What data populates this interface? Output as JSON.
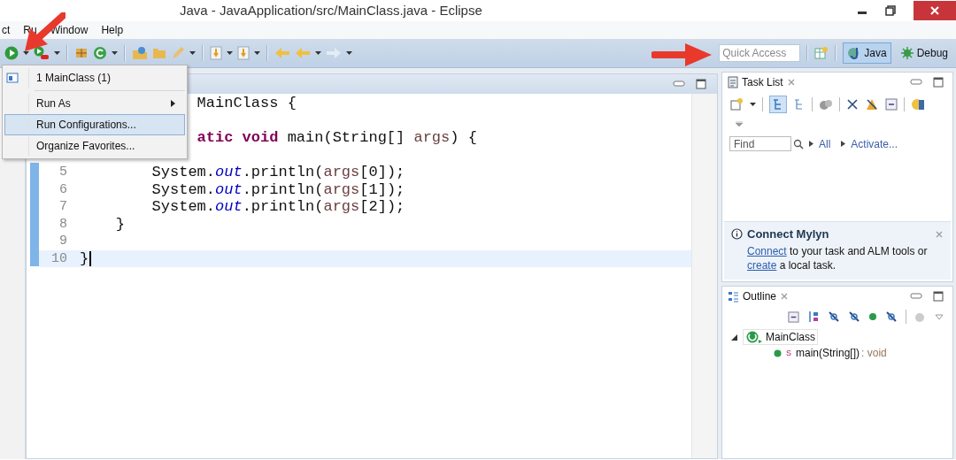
{
  "window": {
    "title": "Java - JavaApplication/src/MainClass.java - Eclipse"
  },
  "menu_bar": [
    "ct",
    "Ru",
    "Window",
    "Help"
  ],
  "quick_access": {
    "placeholder": "Quick Access"
  },
  "perspectives": [
    {
      "label": "Java",
      "selected": true
    },
    {
      "label": "Debug",
      "selected": false
    }
  ],
  "run_menu": [
    {
      "kind": "item",
      "label": "1 MainClass (1)",
      "selected": false
    },
    {
      "kind": "separator"
    },
    {
      "kind": "submenu",
      "label": "Run As",
      "selected": false
    },
    {
      "kind": "item",
      "label": "Run Configurations...",
      "selected": true
    },
    {
      "kind": "item",
      "label": "Organize Favorites...",
      "selected": false
    }
  ],
  "editor": {
    "lines": [
      {
        "current": false,
        "tokens": [
          {
            "kind": "plain",
            "text": "MainClass {"
          }
        ]
      },
      {
        "current": false
      },
      {
        "current": false,
        "tokens": [
          {
            "kind": "keyword",
            "text": "atic void"
          },
          {
            "kind": "plain",
            "text": " main(String[] "
          },
          {
            "kind": "param",
            "text": "args"
          },
          {
            "kind": "plain",
            "text": ") {"
          }
        ]
      },
      {
        "current": false
      },
      {
        "number": "5",
        "current": false,
        "tokens": [
          {
            "kind": "plain",
            "text": "        System."
          },
          {
            "kind": "field",
            "text": "out"
          },
          {
            "kind": "plain",
            "text": ".println("
          },
          {
            "kind": "param",
            "text": "args"
          },
          {
            "kind": "plain",
            "text": "[0]);"
          }
        ]
      },
      {
        "number": "6",
        "current": false,
        "tokens": [
          {
            "kind": "plain",
            "text": "        System."
          },
          {
            "kind": "field",
            "text": "out"
          },
          {
            "kind": "plain",
            "text": ".println("
          },
          {
            "kind": "param",
            "text": "args"
          },
          {
            "kind": "plain",
            "text": "[1]);"
          }
        ]
      },
      {
        "number": "7",
        "current": false,
        "tokens": [
          {
            "kind": "plain",
            "text": "        System."
          },
          {
            "kind": "field",
            "text": "out"
          },
          {
            "kind": "plain",
            "text": ".println("
          },
          {
            "kind": "param",
            "text": "args"
          },
          {
            "kind": "plain",
            "text": "[2]);"
          }
        ]
      },
      {
        "number": "8",
        "current": false,
        "tokens": [
          {
            "kind": "plain",
            "text": "    }"
          }
        ]
      },
      {
        "number": "9",
        "current": false
      },
      {
        "number": "10",
        "current": true,
        "tokens": [
          {
            "kind": "plain",
            "text": "}"
          }
        ]
      }
    ]
  },
  "task_list": {
    "title": "Task List",
    "find": {
      "placeholder": "Find"
    },
    "filters": [
      "All",
      "Activate..."
    ]
  },
  "mylyn": {
    "title": "Connect Mylyn",
    "parts": [
      {
        "kind": "link",
        "text": "Connect"
      },
      {
        "kind": "plain",
        "text": " to your task and ALM tools or "
      },
      {
        "kind": "link",
        "text": "create"
      },
      {
        "kind": "plain",
        "text": " a local task."
      }
    ]
  },
  "outline": {
    "title": "Outline",
    "tree": [
      {
        "label": "MainClass",
        "expanded": true,
        "children": [
          {
            "label": "main(String[])",
            "modifier": "S",
            "type": " : void"
          }
        ]
      }
    ]
  }
}
